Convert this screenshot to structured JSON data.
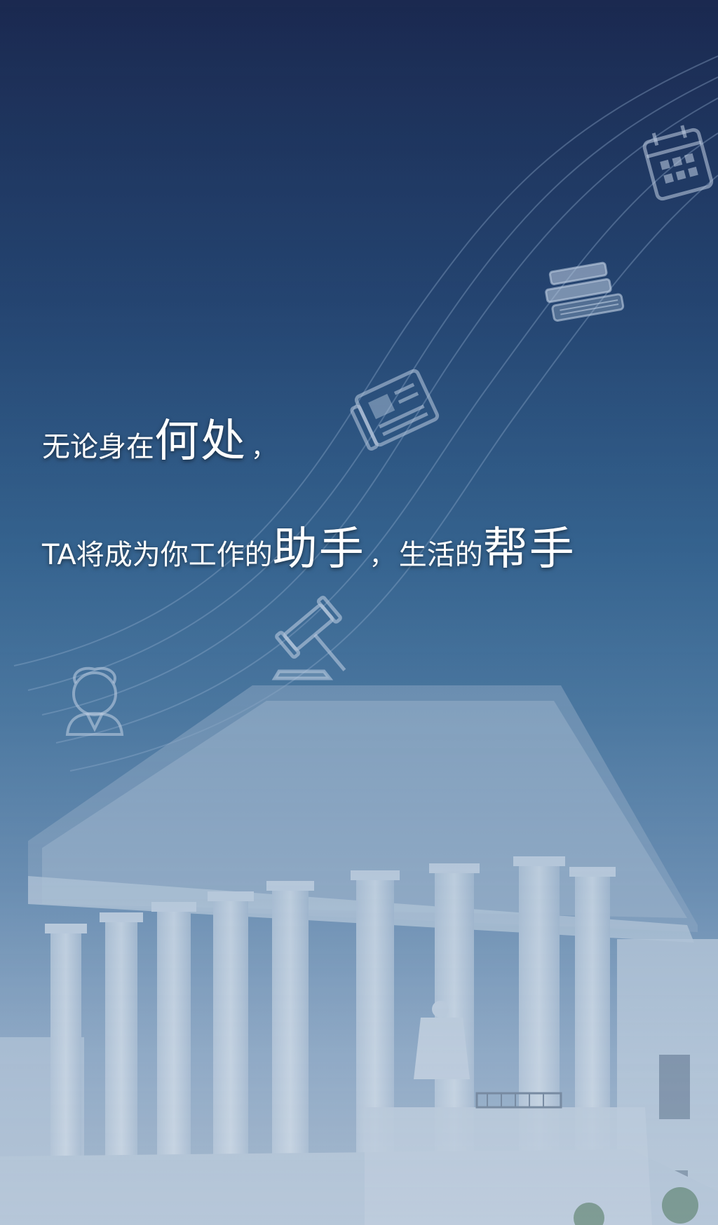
{
  "background": {
    "top_color": "#1b2950",
    "bottom_color": "#aebfd2",
    "scene": "courthouse-building"
  },
  "icons": [
    "calendar-icon",
    "books-icon",
    "newspaper-icon",
    "gavel-icon",
    "judge-icon"
  ],
  "headline": {
    "line1": {
      "part1": "无论身在",
      "emphasis": "何处",
      "comma": "，"
    },
    "line2": {
      "part1": "TA将成为你工作的",
      "emphasis1": "助手",
      "comma": "，",
      "part2": "生活的",
      "emphasis2": "帮手"
    }
  }
}
